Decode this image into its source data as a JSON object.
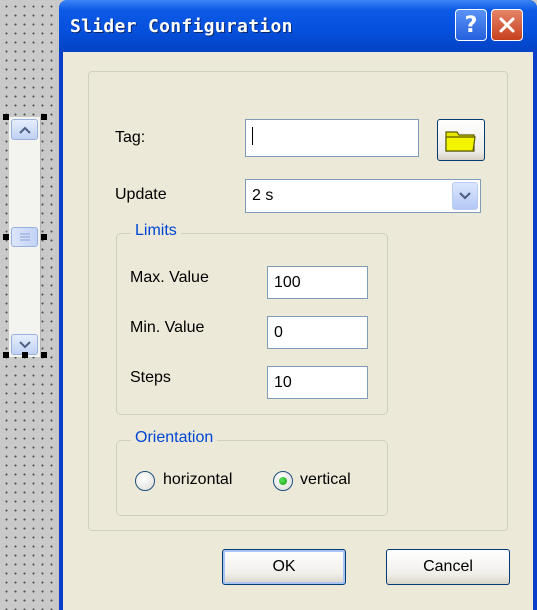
{
  "dialog": {
    "title": "Slider Configuration",
    "help_glyph": "?",
    "close_glyph": "✕"
  },
  "form": {
    "tag": {
      "label": "Tag:",
      "value": ""
    },
    "update": {
      "label": "Update",
      "value": "2 s"
    },
    "limits": {
      "title": "Limits",
      "max": {
        "label": "Max. Value",
        "value": "100"
      },
      "min": {
        "label": "Min. Value",
        "value": "0"
      },
      "steps": {
        "label": "Steps",
        "value": "10"
      }
    },
    "orientation": {
      "title": "Orientation",
      "options": [
        {
          "label": "horizontal",
          "selected": false
        },
        {
          "label": "vertical",
          "selected": true
        }
      ]
    }
  },
  "buttons": {
    "ok": "OK",
    "cancel": "Cancel"
  },
  "icons": {
    "help": "help-icon",
    "close": "close-icon",
    "folder": "folder-icon",
    "dropdown": "chevron-down-icon"
  },
  "colors": {
    "titlebar": "#0550dc",
    "client": "#ece9d8",
    "group_title": "#0046d5",
    "close_button": "#c7401e",
    "folder": "#e8e800"
  }
}
